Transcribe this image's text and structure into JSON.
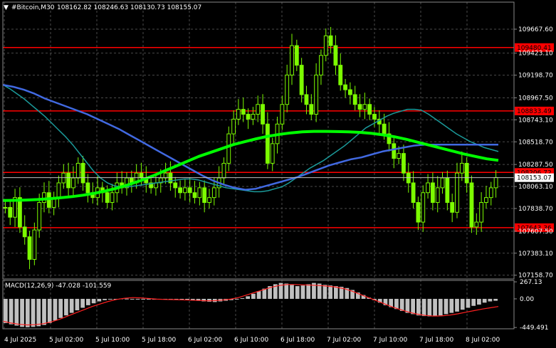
{
  "header": {
    "symbol_text": "#Bitcoin,M30",
    "ohlc_text": "108162.82 108246.63 108130.73 108155.07"
  },
  "colors": {
    "background": "#000000",
    "grid": "#4a4a4a",
    "candle": "#7cfc00",
    "level_line": "#ff0000",
    "level_label_bg": "#ff0000",
    "current_price_line": "#c0c0c0",
    "current_price_bg": "#ffffff",
    "ma_fast": "#1b9a9a",
    "ma_mid": "#4169e1",
    "ma_slow": "#00ff00",
    "macd_hist": "#c0c0c0",
    "macd_signal": "#ff2020",
    "axis_text": "#ffffff"
  },
  "chart_data": {
    "type": "candlestick",
    "price_axis": {
      "ticks": [
        "109667.60",
        "109423.10",
        "109198.70",
        "108967.50",
        "108743.10",
        "108518.70",
        "108287.50",
        "108063.10",
        "107838.70",
        "107607.50",
        "107383.10",
        "107158.70"
      ],
      "range": [
        107120,
        109820
      ]
    },
    "time_axis": {
      "labels": [
        "4 Jul 2025",
        "5 Jul 02:00",
        "5 Jul 10:00",
        "5 Jul 18:00",
        "6 Jul 02:00",
        "6 Jul 10:00",
        "6 Jul 18:00",
        "7 Jul 02:00",
        "7 Jul 10:00",
        "7 Jul 18:00",
        "8 Jul 02:00"
      ]
    },
    "levels": [
      {
        "label": "109480.41",
        "value": 109480.41
      },
      {
        "label": "108833.49",
        "value": 108833.49
      },
      {
        "label": "108206.72",
        "value": 108206.72
      },
      {
        "label": "107643.36",
        "value": 107643.36
      }
    ],
    "current_price": {
      "label": "108153.07",
      "value": 108153.07
    },
    "close_series": [
      107850,
      107750,
      107950,
      107650,
      107550,
      107320,
      107620,
      107900,
      108000,
      107850,
      107950,
      108100,
      108200,
      108050,
      108150,
      108300,
      108100,
      108000,
      107950,
      108050,
      108000,
      107900,
      108000,
      108100,
      108050,
      108150,
      108100,
      108200,
      108150,
      108100,
      108050,
      108100,
      108150,
      108200,
      108100,
      108050,
      108000,
      108050,
      108000,
      107950,
      108050,
      107900,
      107950,
      108050,
      108150,
      108300,
      108600,
      108750,
      108850,
      108800,
      108750,
      108800,
      108900,
      108700,
      108300,
      108500,
      108700,
      108900,
      109200,
      109500,
      109300,
      109000,
      108900,
      108800,
      109200,
      109400,
      109600,
      109500,
      109300,
      109100,
      109050,
      109000,
      108900,
      108850,
      108900,
      108800,
      108750,
      108700,
      108600,
      108500,
      108350,
      108400,
      108200,
      108100,
      107900,
      107700,
      108000,
      108100,
      107900,
      108050,
      108150,
      107900,
      107800,
      108200,
      108300,
      108100,
      107650,
      107700,
      107900,
      107950,
      108050,
      108155
    ],
    "ma_fast": [
      109100,
      109060,
      109010,
      108960,
      108900,
      108840,
      108780,
      108710,
      108640,
      108570,
      108490,
      108400,
      108310,
      108220,
      108150,
      108100,
      108070,
      108060,
      108060,
      108070,
      108080,
      108090,
      108100,
      108110,
      108120,
      108130,
      108140,
      108140,
      108130,
      108110,
      108090,
      108070,
      108050,
      108040,
      108030,
      108020,
      108010,
      108010,
      108020,
      108040,
      108060,
      108100,
      108150,
      108200,
      108250,
      108290,
      108330,
      108380,
      108430,
      108480,
      108540,
      108600,
      108660,
      108700,
      108740,
      108780,
      108810,
      108830,
      108850,
      108850,
      108840,
      108800,
      108750,
      108700,
      108650,
      108600,
      108560,
      108520,
      108490,
      108460,
      108440,
      108420
    ],
    "ma_mid": [
      109100,
      109080,
      109050,
      109010,
      108960,
      108920,
      108880,
      108840,
      108800,
      108750,
      108700,
      108650,
      108590,
      108530,
      108470,
      108410,
      108350,
      108290,
      108230,
      108170,
      108120,
      108080,
      108050,
      108030,
      108040,
      108070,
      108100,
      108130,
      108160,
      108200,
      108240,
      108280,
      108310,
      108340,
      108360,
      108390,
      108420,
      108440,
      108460,
      108480,
      108490,
      108490,
      108490,
      108490,
      108490,
      108490,
      108490,
      108490
    ],
    "ma_slow": [
      107920,
      107922,
      107925,
      107930,
      107938,
      107948,
      107960,
      107975,
      107995,
      108020,
      108050,
      108085,
      108125,
      108170,
      108220,
      108270,
      108320,
      108370,
      108410,
      108450,
      108490,
      108520,
      108550,
      108575,
      108595,
      108610,
      108620,
      108625,
      108625,
      108623,
      108620,
      108615,
      108605,
      108590,
      108570,
      108545,
      108515,
      108485,
      108455,
      108425,
      108395,
      108370,
      108345,
      108330
    ],
    "macd": {
      "label": "MACD(12,26,9) -47.028 -101.559",
      "ticks": [
        "267.13",
        "0.00",
        "-449.491"
      ],
      "range": [
        -470,
        290
      ],
      "histogram": [
        -380,
        -400,
        -420,
        -440,
        -445,
        -440,
        -430,
        -410,
        -380,
        -340,
        -300,
        -260,
        -220,
        -180,
        -140,
        -100,
        -70,
        -40,
        -20,
        -5,
        0,
        5,
        3,
        -2,
        -5,
        -8,
        -10,
        -12,
        -10,
        -8,
        -5,
        -10,
        -15,
        -20,
        -25,
        -30,
        -40,
        -45,
        -50,
        -40,
        -30,
        -20,
        -10,
        10,
        40,
        80,
        120,
        160,
        200,
        230,
        250,
        240,
        220,
        200,
        210,
        230,
        250,
        240,
        220,
        210,
        200,
        190,
        170,
        140,
        100,
        60,
        20,
        -20,
        -60,
        -100,
        -130,
        -160,
        -190,
        -220,
        -240,
        -260,
        -270,
        -275,
        -270,
        -260,
        -240,
        -220,
        -200,
        -170,
        -140,
        -110,
        -90,
        -60,
        -40,
        -30
      ],
      "signal": [
        -350,
        -380,
        -400,
        -410,
        -405,
        -390,
        -360,
        -320,
        -270,
        -220,
        -170,
        -120,
        -80,
        -40,
        -10,
        10,
        20,
        15,
        5,
        -5,
        -10,
        -12,
        -15,
        -20,
        -25,
        -30,
        -28,
        -20,
        -5,
        20,
        60,
        100,
        140,
        180,
        210,
        225,
        225,
        220,
        215,
        210,
        200,
        185,
        160,
        120,
        70,
        20,
        -30,
        -80,
        -130,
        -170,
        -210,
        -240,
        -260,
        -270,
        -268,
        -255,
        -235,
        -210,
        -185,
        -160,
        -140,
        -120
      ]
    }
  }
}
